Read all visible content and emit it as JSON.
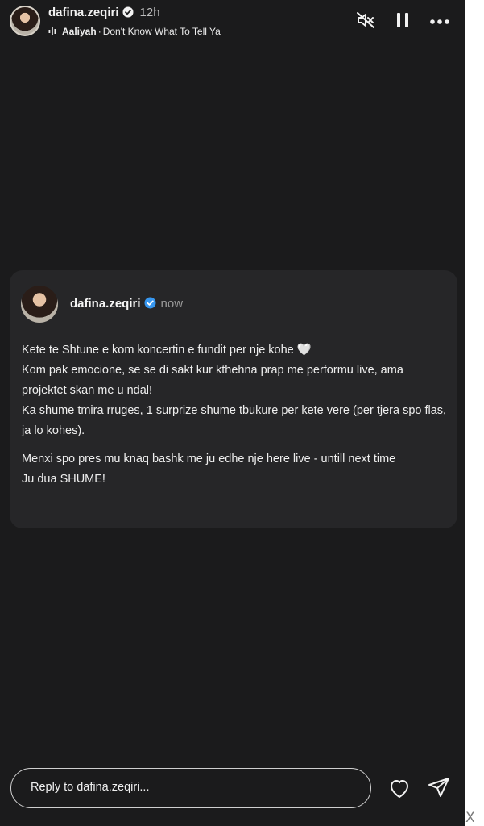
{
  "header": {
    "username": "dafina.zeqiri",
    "time": "12h",
    "music": {
      "artist": "Aaliyah",
      "separator": "·",
      "track": "Don't Know What To Tell Ya"
    }
  },
  "icons": {
    "verified": "verified-badge-icon",
    "music": "music-bars-icon",
    "mute": "speaker-muted-icon",
    "pause": "pause-icon",
    "more": "more-dots-icon",
    "heart": "heart-icon",
    "send": "send-icon"
  },
  "post": {
    "username": "dafina.zeqiri",
    "time": "now",
    "lines": [
      "Kete te Shtune e kom koncertin e fundit per nje kohe 🤍",
      "Kom pak emocione, se se di sakt kur kthehna prap me performu live, ama projektet skan me u ndal!",
      "Ka shume tmira rruges, 1 surprize shume tbukure per kete vere (per tjera spo flas, ja lo kohes)."
    ],
    "lines2": [
      "Menxi spo pres mu knaq bashk me ju edhe nje here live - untill next time",
      "Ju dua SHUME!"
    ]
  },
  "reply": {
    "placeholder": "Reply to dafina.zeqiri..."
  },
  "close_label": "X",
  "colors": {
    "background": "#1b1b1c",
    "card": "#262628",
    "verified": "#3797f0"
  }
}
